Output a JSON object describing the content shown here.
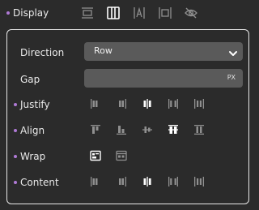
{
  "display": {
    "label": "Display",
    "options": [
      {
        "icon": "display-block-icon",
        "active": false
      },
      {
        "icon": "display-flex-icon",
        "active": true
      },
      {
        "icon": "display-inline-icon",
        "active": false
      },
      {
        "icon": "display-inline-block-icon",
        "active": false
      },
      {
        "icon": "display-none-icon",
        "active": false
      }
    ]
  },
  "direction": {
    "label": "Direction",
    "value": "Row"
  },
  "gap": {
    "label": "Gap",
    "value": "",
    "unit": "PX"
  },
  "justify": {
    "label": "Justify",
    "options": [
      {
        "icon": "justify-start-icon",
        "active": false
      },
      {
        "icon": "justify-end-icon",
        "active": false
      },
      {
        "icon": "justify-center-icon",
        "active": true
      },
      {
        "icon": "justify-space-between-icon",
        "active": false
      },
      {
        "icon": "justify-space-around-icon",
        "active": false
      }
    ]
  },
  "align": {
    "label": "Align",
    "options": [
      {
        "icon": "align-start-icon",
        "active": false
      },
      {
        "icon": "align-end-icon",
        "active": false
      },
      {
        "icon": "align-center-icon",
        "active": false
      },
      {
        "icon": "align-baseline-icon",
        "active": true
      },
      {
        "icon": "align-stretch-icon",
        "active": false
      }
    ]
  },
  "wrap": {
    "label": "Wrap",
    "options": [
      {
        "icon": "wrap-icon",
        "active": true
      },
      {
        "icon": "no-wrap-icon",
        "active": false
      }
    ]
  },
  "content": {
    "label": "Content",
    "options": [
      {
        "icon": "content-start-icon",
        "active": false
      },
      {
        "icon": "content-end-icon",
        "active": false
      },
      {
        "icon": "content-center-icon",
        "active": true
      },
      {
        "icon": "content-space-between-icon",
        "active": false
      },
      {
        "icon": "content-space-around-icon",
        "active": false
      }
    ]
  },
  "colors": {
    "dot": "#b07ad6",
    "icon_inactive": "#8f8f8f",
    "icon_active": "#ffffff",
    "field_bg": "#5a5a5a"
  }
}
